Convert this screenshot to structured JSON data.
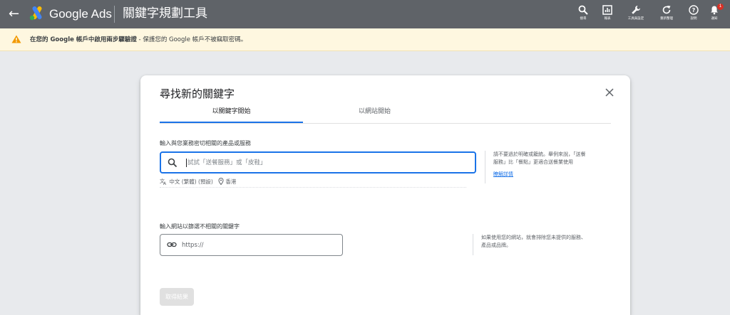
{
  "app": {
    "product_name": "Google Ads",
    "page_title": "關鍵字規劃工具"
  },
  "toolbar": {
    "items": [
      {
        "label": "搜尋",
        "icon": "search-icon"
      },
      {
        "label": "報表",
        "icon": "reports-icon"
      },
      {
        "label": "工具與設定",
        "icon": "wrench-icon"
      },
      {
        "label": "重新整理",
        "icon": "refresh-icon"
      },
      {
        "label": "說明",
        "icon": "help-icon"
      },
      {
        "label": "通知",
        "icon": "bell-icon"
      }
    ],
    "notification_count": "1"
  },
  "banner": {
    "bold_text": "在您的 Google 帳戶中啟用兩步驟驗證",
    "rest_text": " - 保護您的 Google 帳戶不被竊取密碼。",
    "icon": "warning-icon"
  },
  "dialog": {
    "title": "尋找新的關鍵字",
    "tabs": [
      {
        "label": "以關鍵字開始",
        "active": true
      },
      {
        "label": "以網站開始",
        "active": false
      }
    ],
    "keyword_section": {
      "label": "輸入與您業務密切相關的產品或服務",
      "placeholder": "試試「送餐服務」或「皮鞋」",
      "language": "中文 (繁體) (預設)",
      "location": "香港",
      "help_line1": "請不要過於明確或籠統。舉例來說，「送餐",
      "help_line2": "服務」比「餐點」更適合送餐業使用",
      "help_link": "瞭解詳情"
    },
    "website_section": {
      "label": "輸入網站以篩選不相關的關鍵字",
      "placeholder": "https://",
      "help_line1": "如果使用您的網站，就會排除您未提供的服務、",
      "help_line2": "產品或品牌。"
    },
    "submit_label": "取得結果"
  },
  "colors": {
    "topbar": "#5f6368",
    "accent": "#1a73e8",
    "banner_bg": "#fef7e0",
    "warning": "#f29900",
    "badge": "#d93025"
  }
}
